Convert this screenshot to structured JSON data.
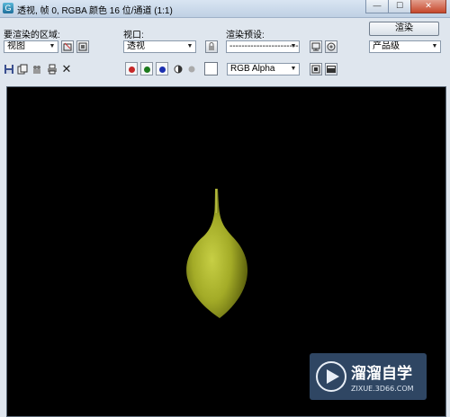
{
  "window": {
    "title": "透视, 帧 0, RGBA 颜色 16 位/通道 (1:1)",
    "controls": {
      "minimize": "—",
      "maximize": "☐",
      "close": "✕"
    }
  },
  "region": {
    "label": "要渲染的区域:",
    "value": "视图"
  },
  "viewport": {
    "label": "视口:",
    "value": "透视"
  },
  "preset": {
    "label": "渲染预设:",
    "value": "--------------------------"
  },
  "render": {
    "button_label": "渲染",
    "quality_value": "产品级"
  },
  "toolbar": {
    "channel_colors": {
      "red": "#c62828",
      "green": "#1c7a1c",
      "blue": "#1b2fb0",
      "mono": "#555555",
      "gray": "#aaaaaa"
    },
    "channel_select_value": "RGB Alpha"
  },
  "scene": {
    "background": "#000000",
    "object_color": "#a8b02a"
  },
  "watermark": {
    "brand": "溜溜自学",
    "url": "ZIXUE.3D66.COM"
  }
}
